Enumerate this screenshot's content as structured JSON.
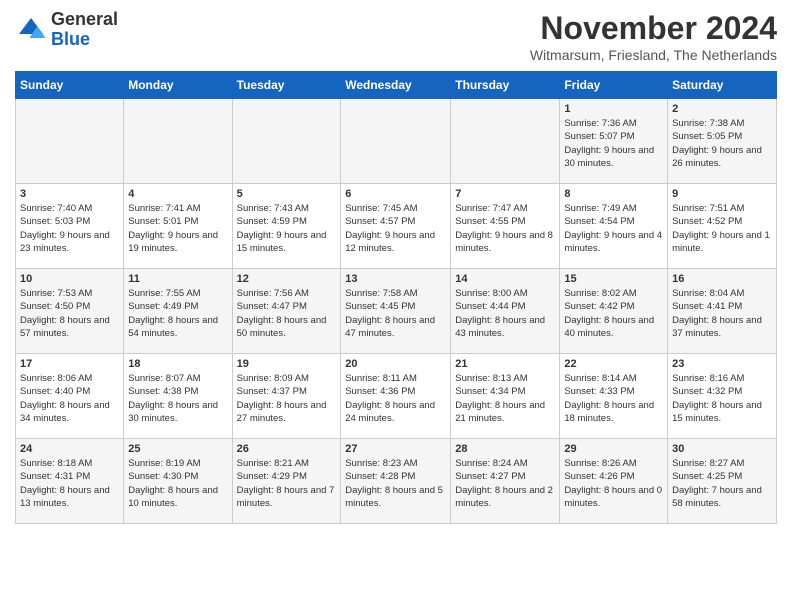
{
  "logo": {
    "general": "General",
    "blue": "Blue"
  },
  "header": {
    "month": "November 2024",
    "location": "Witmarsum, Friesland, The Netherlands"
  },
  "weekdays": [
    "Sunday",
    "Monday",
    "Tuesday",
    "Wednesday",
    "Thursday",
    "Friday",
    "Saturday"
  ],
  "weeks": [
    [
      {
        "day": "",
        "info": ""
      },
      {
        "day": "",
        "info": ""
      },
      {
        "day": "",
        "info": ""
      },
      {
        "day": "",
        "info": ""
      },
      {
        "day": "",
        "info": ""
      },
      {
        "day": "1",
        "info": "Sunrise: 7:36 AM\nSunset: 5:07 PM\nDaylight: 9 hours and 30 minutes."
      },
      {
        "day": "2",
        "info": "Sunrise: 7:38 AM\nSunset: 5:05 PM\nDaylight: 9 hours and 26 minutes."
      }
    ],
    [
      {
        "day": "3",
        "info": "Sunrise: 7:40 AM\nSunset: 5:03 PM\nDaylight: 9 hours and 23 minutes."
      },
      {
        "day": "4",
        "info": "Sunrise: 7:41 AM\nSunset: 5:01 PM\nDaylight: 9 hours and 19 minutes."
      },
      {
        "day": "5",
        "info": "Sunrise: 7:43 AM\nSunset: 4:59 PM\nDaylight: 9 hours and 15 minutes."
      },
      {
        "day": "6",
        "info": "Sunrise: 7:45 AM\nSunset: 4:57 PM\nDaylight: 9 hours and 12 minutes."
      },
      {
        "day": "7",
        "info": "Sunrise: 7:47 AM\nSunset: 4:55 PM\nDaylight: 9 hours and 8 minutes."
      },
      {
        "day": "8",
        "info": "Sunrise: 7:49 AM\nSunset: 4:54 PM\nDaylight: 9 hours and 4 minutes."
      },
      {
        "day": "9",
        "info": "Sunrise: 7:51 AM\nSunset: 4:52 PM\nDaylight: 9 hours and 1 minute."
      }
    ],
    [
      {
        "day": "10",
        "info": "Sunrise: 7:53 AM\nSunset: 4:50 PM\nDaylight: 8 hours and 57 minutes."
      },
      {
        "day": "11",
        "info": "Sunrise: 7:55 AM\nSunset: 4:49 PM\nDaylight: 8 hours and 54 minutes."
      },
      {
        "day": "12",
        "info": "Sunrise: 7:56 AM\nSunset: 4:47 PM\nDaylight: 8 hours and 50 minutes."
      },
      {
        "day": "13",
        "info": "Sunrise: 7:58 AM\nSunset: 4:45 PM\nDaylight: 8 hours and 47 minutes."
      },
      {
        "day": "14",
        "info": "Sunrise: 8:00 AM\nSunset: 4:44 PM\nDaylight: 8 hours and 43 minutes."
      },
      {
        "day": "15",
        "info": "Sunrise: 8:02 AM\nSunset: 4:42 PM\nDaylight: 8 hours and 40 minutes."
      },
      {
        "day": "16",
        "info": "Sunrise: 8:04 AM\nSunset: 4:41 PM\nDaylight: 8 hours and 37 minutes."
      }
    ],
    [
      {
        "day": "17",
        "info": "Sunrise: 8:06 AM\nSunset: 4:40 PM\nDaylight: 8 hours and 34 minutes."
      },
      {
        "day": "18",
        "info": "Sunrise: 8:07 AM\nSunset: 4:38 PM\nDaylight: 8 hours and 30 minutes."
      },
      {
        "day": "19",
        "info": "Sunrise: 8:09 AM\nSunset: 4:37 PM\nDaylight: 8 hours and 27 minutes."
      },
      {
        "day": "20",
        "info": "Sunrise: 8:11 AM\nSunset: 4:36 PM\nDaylight: 8 hours and 24 minutes."
      },
      {
        "day": "21",
        "info": "Sunrise: 8:13 AM\nSunset: 4:34 PM\nDaylight: 8 hours and 21 minutes."
      },
      {
        "day": "22",
        "info": "Sunrise: 8:14 AM\nSunset: 4:33 PM\nDaylight: 8 hours and 18 minutes."
      },
      {
        "day": "23",
        "info": "Sunrise: 8:16 AM\nSunset: 4:32 PM\nDaylight: 8 hours and 15 minutes."
      }
    ],
    [
      {
        "day": "24",
        "info": "Sunrise: 8:18 AM\nSunset: 4:31 PM\nDaylight: 8 hours and 13 minutes."
      },
      {
        "day": "25",
        "info": "Sunrise: 8:19 AM\nSunset: 4:30 PM\nDaylight: 8 hours and 10 minutes."
      },
      {
        "day": "26",
        "info": "Sunrise: 8:21 AM\nSunset: 4:29 PM\nDaylight: 8 hours and 7 minutes."
      },
      {
        "day": "27",
        "info": "Sunrise: 8:23 AM\nSunset: 4:28 PM\nDaylight: 8 hours and 5 minutes."
      },
      {
        "day": "28",
        "info": "Sunrise: 8:24 AM\nSunset: 4:27 PM\nDaylight: 8 hours and 2 minutes."
      },
      {
        "day": "29",
        "info": "Sunrise: 8:26 AM\nSunset: 4:26 PM\nDaylight: 8 hours and 0 minutes."
      },
      {
        "day": "30",
        "info": "Sunrise: 8:27 AM\nSunset: 4:25 PM\nDaylight: 7 hours and 58 minutes."
      }
    ]
  ]
}
